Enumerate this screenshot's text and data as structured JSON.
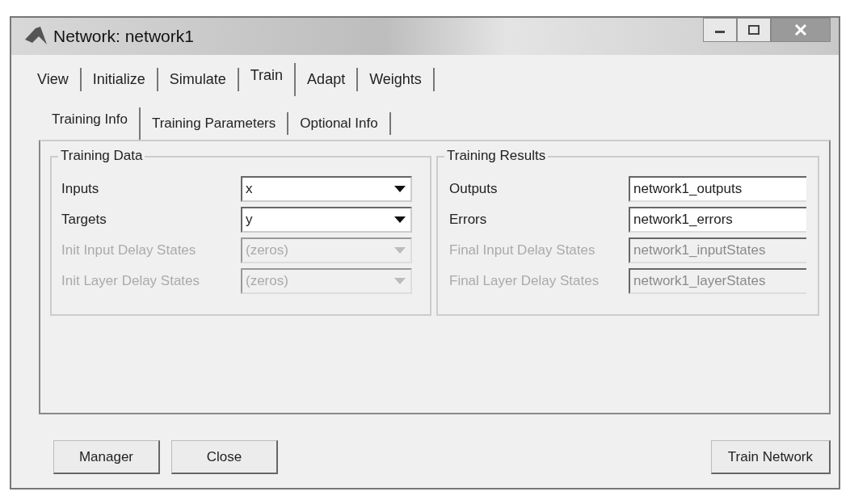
{
  "window": {
    "title": "Network: network1"
  },
  "tabs": [
    {
      "label": "View",
      "selected": false
    },
    {
      "label": "Initialize",
      "selected": false
    },
    {
      "label": "Simulate",
      "selected": false
    },
    {
      "label": "Train",
      "selected": true
    },
    {
      "label": "Adapt",
      "selected": false
    },
    {
      "label": "Weights",
      "selected": false
    }
  ],
  "subtabs": [
    {
      "label": "Training Info",
      "selected": true
    },
    {
      "label": "Training Parameters",
      "selected": false
    },
    {
      "label": "Optional Info",
      "selected": false
    }
  ],
  "groups": [
    {
      "title": "Training Data",
      "rows": [
        {
          "label": "Inputs",
          "kind": "dropdown",
          "value": "x",
          "disabled": false
        },
        {
          "label": "Targets",
          "kind": "dropdown",
          "value": "y",
          "disabled": false
        },
        {
          "label": "Init Input Delay States",
          "kind": "dropdown",
          "value": "(zeros)",
          "disabled": true
        },
        {
          "label": "Init Layer Delay States",
          "kind": "dropdown",
          "value": "(zeros)",
          "disabled": true
        }
      ]
    },
    {
      "title": "Training Results",
      "rows": [
        {
          "label": "Outputs",
          "kind": "text",
          "value": "network1_outputs",
          "disabled": false
        },
        {
          "label": "Errors",
          "kind": "text",
          "value": "network1_errors",
          "disabled": false
        },
        {
          "label": "Final Input Delay States",
          "kind": "text",
          "value": "network1_inputStates",
          "disabled": true
        },
        {
          "label": "Final Layer Delay States",
          "kind": "text",
          "value": "network1_layerStates",
          "disabled": true
        }
      ]
    }
  ],
  "buttons_left": [
    "Manager",
    "Close"
  ],
  "buttons_right": [
    "Train Network"
  ]
}
